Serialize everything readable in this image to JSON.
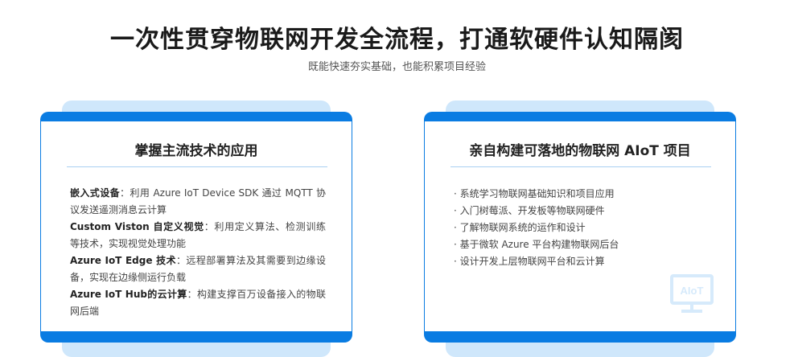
{
  "header": {
    "title": "一次性贯穿物联网开发全流程，打通软硬件认知隔阂",
    "subtitle": "既能快速夯实基础，也能积累项目经验"
  },
  "card_left": {
    "title": "掌握主流技术的应用",
    "items": [
      {
        "label": "嵌入式设备",
        "text": "：利用 Azure IoT Device SDK 通过 MQTT 协议发送遥测消息云计算"
      },
      {
        "label": "Custom Viston 自定义视觉",
        "text": "：利用定义算法、检测训练等技术，实现视觉处理功能"
      },
      {
        "label": "Azure IoT Edge 技术",
        "text": "：远程部署算法及其需要到边缘设备，实现在边缘侧运行负载"
      },
      {
        "label": "Azure IoT Hub的云计算",
        "text": "：构建支撑百万设备接入的物联网后端"
      }
    ]
  },
  "card_right": {
    "title": "亲自构建可落地的物联网 AIoT 项目",
    "items": [
      "· 系统学习物联网基础知识和项目应用",
      "· 入门树莓派、开发板等物联网硬件",
      "· 了解物联网系统的运作和设计",
      "· 基于微软 Azure 平台构建物联网后台",
      "· 设计开发上层物联网平台和云计算"
    ],
    "icon_text": "AIoT"
  },
  "colors": {
    "accent": "#0a7ce2",
    "card_back": "#cfe7fb",
    "separator": "#a9d0f2"
  }
}
